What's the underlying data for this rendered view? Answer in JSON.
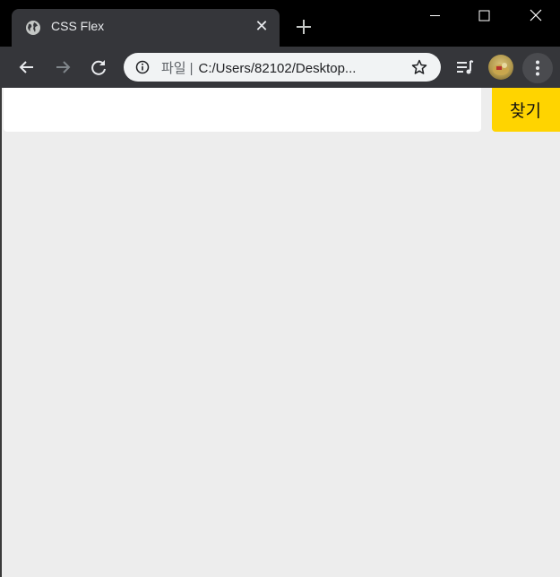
{
  "browser": {
    "tab": {
      "title": "CSS Flex",
      "favicon": "globe-icon",
      "close": "✕"
    },
    "new_tab": "plus-icon",
    "window_controls": [
      "minimize-icon",
      "maximize-icon",
      "close-icon"
    ],
    "toolbar": {
      "back": "back-arrow-icon",
      "forward": "forward-arrow-icon",
      "reload": "reload-icon",
      "omnibox": {
        "scheme": "파일",
        "separator": "|",
        "url": "C:/Users/82102/Desktop..."
      },
      "bookmark": "star-icon",
      "media": "media-queue-icon",
      "menu": "more-vert-icon"
    }
  },
  "page": {
    "search": {
      "value": "",
      "button_label": "찾기"
    }
  },
  "colors": {
    "tab_bg": "#35363a",
    "page_bg": "#ededed",
    "button_bg": "#ffd400"
  }
}
